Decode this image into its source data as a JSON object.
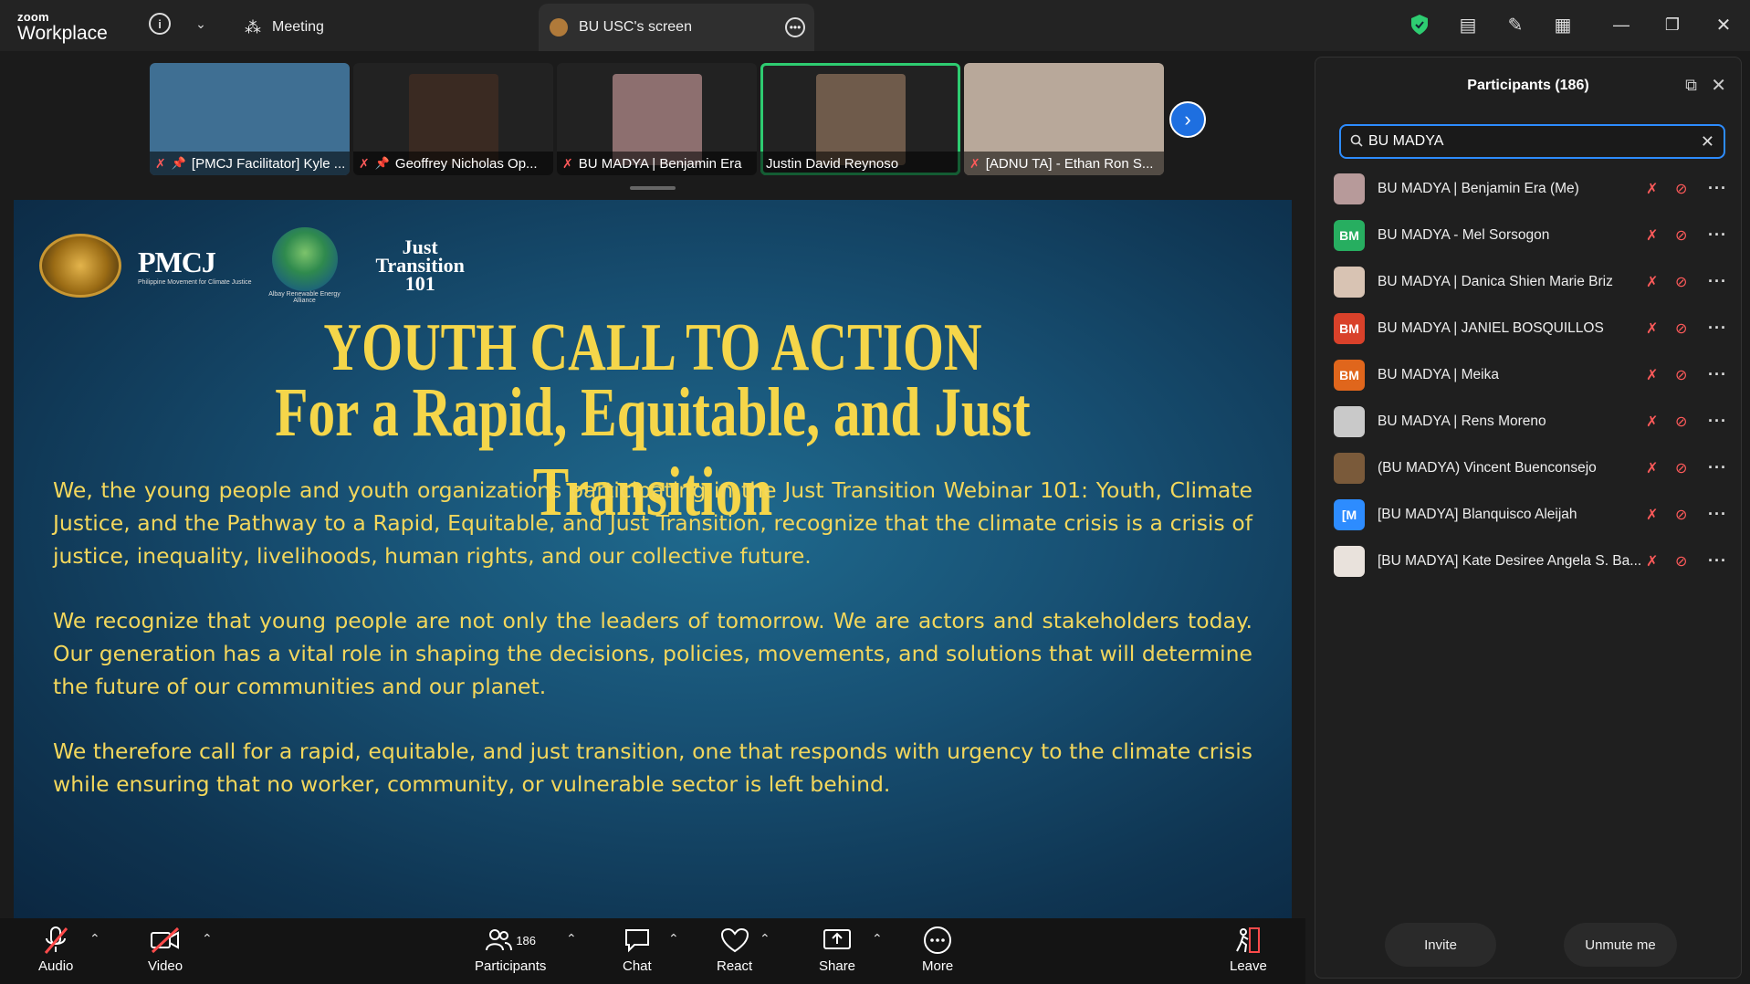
{
  "app": {
    "brand_top": "zoom",
    "brand_bottom": "Workplace"
  },
  "tabs": [
    {
      "label": "Meeting"
    },
    {
      "label": "BU USC's screen"
    }
  ],
  "video_strip": [
    {
      "name": "[PMCJ Facilitator] Kyle ...",
      "muted": true,
      "pinned": true,
      "active": false,
      "bg": "#3f6f93"
    },
    {
      "name": "Geoffrey Nicholas Op...",
      "muted": true,
      "pinned": true,
      "active": false,
      "bg": "#3a2a22"
    },
    {
      "name": "BU MADYA | Benjamin Era",
      "muted": true,
      "pinned": false,
      "active": false,
      "bg": "#8d6f6f"
    },
    {
      "name": "Justin David Reynoso",
      "muted": false,
      "pinned": false,
      "active": true,
      "bg": "#6f5b4b"
    },
    {
      "name": "[ADNU TA] - Ethan Ron S...",
      "muted": true,
      "pinned": false,
      "active": false,
      "bg": "#b8a89a"
    }
  ],
  "slide": {
    "title_line1": "YOUTH CALL TO ACTION",
    "title_line2": "For a Rapid, Equitable, and Just Transition",
    "paragraphs": [
      "We, the young people and youth organizations participating in the Just Transition Webinar 101: Youth, Climate Justice, and the Pathway to a Rapid, Equitable, and Just Transition, recognize that the climate crisis is a crisis of justice, inequality, livelihoods, human rights, and our collective future.",
      "We recognize that young people are not only the leaders of tomorrow. We are actors and stakeholders today. Our generation has a vital role in shaping the decisions, policies, movements, and solutions that will determine the future of our communities and our planet.",
      "We therefore call for a rapid, equitable, and just transition, one that responds with urgency to the climate crisis while ensuring that no worker, community, or vulnerable sector is left behind."
    ],
    "logos": {
      "pmcj": "PMCJ",
      "pmcj_sub": "Philippine Movement for Climate Justice",
      "albay": "Albay Renewable Energy Alliance",
      "jt_line1": "Just",
      "jt_line2": "Transition",
      "jt_line3": "101"
    }
  },
  "toolbar": {
    "audio": "Audio",
    "video": "Video",
    "participants": "Participants",
    "participants_count": "186",
    "chat": "Chat",
    "react": "React",
    "share": "Share",
    "more": "More",
    "leave": "Leave"
  },
  "panel": {
    "title": "Participants (186)",
    "search_value": "BU MADYA",
    "invite": "Invite",
    "unmute_me": "Unmute me",
    "participants": [
      {
        "name": "BU MADYA | Benjamin Era (Me)",
        "initials": "",
        "color": "#b79a9a"
      },
      {
        "name": "BU MADYA - Mel Sorsogon",
        "initials": "BM",
        "color": "#27ae60"
      },
      {
        "name": "BU MADYA | Danica Shien Marie Briz",
        "initials": "",
        "color": "#d8c3b3"
      },
      {
        "name": "BU MADYA | JANIEL BOSQUILLOS",
        "initials": "BM",
        "color": "#d9412a"
      },
      {
        "name": "BU MADYA | Meika",
        "initials": "BM",
        "color": "#e0661c"
      },
      {
        "name": "BU MADYA | Rens Moreno",
        "initials": "",
        "color": "#c9c9c9"
      },
      {
        "name": "(BU MADYA) Vincent Buenconsejo",
        "initials": "",
        "color": "#7a5a3a"
      },
      {
        "name": "[BU MADYA] Blanquisco Aleijah",
        "initials": "[M",
        "color": "#2d8cff"
      },
      {
        "name": "[BU MADYA] Kate Desiree Angela S. Ba...",
        "initials": "",
        "color": "#e9e2dc"
      }
    ]
  }
}
